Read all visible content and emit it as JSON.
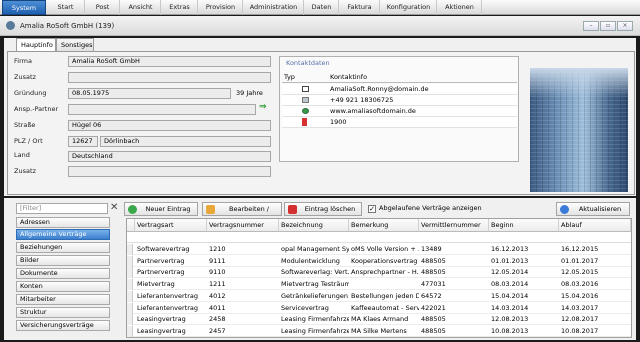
{
  "menu": {
    "items": [
      "System",
      "Start",
      "Post",
      "Ansicht",
      "Extras",
      "Provision",
      "Administration",
      "Daten",
      "Faktura",
      "Konfiguration",
      "Aktionen"
    ]
  },
  "window": {
    "title": "Amalia RoSoft GmbH (139)",
    "controls": [
      "–",
      "▫",
      "×"
    ]
  },
  "tabs": [
    "Hauptinfo",
    "Sonstiges"
  ],
  "form": {
    "firma_label": "Firma",
    "firma": "Amalia RoSoft GmbH",
    "zusatz_label": "Zusatz",
    "zusatz": "",
    "gruendung_label": "Gründung",
    "gruendung": "08.05.1975",
    "alter": "39 Jahre",
    "ansp_label": "Ansp.-Partner",
    "ansp": "",
    "strasse_label": "Straße",
    "strasse": "Hügel 06",
    "plz_label": "PLZ / Ort",
    "plz": "12627",
    "ort": "Dörlinbach",
    "land_label": "Land",
    "land": "Deutschland",
    "zusatz2_label": "Zusatz",
    "zusatz2": ""
  },
  "contact": {
    "title": "Kontaktdaten",
    "col_typ": "Typ",
    "col_info": "Kontaktinfo",
    "rows": [
      {
        "icon": "envelope-icon",
        "value": "AmaliaSoft.Ronny@domain.de"
      },
      {
        "icon": "phone-icon",
        "value": "+49 921 18306725"
      },
      {
        "icon": "globe-icon",
        "value": "www.amaliasoftdomain.de"
      },
      {
        "icon": "mobile-icon",
        "value": "1900"
      }
    ]
  },
  "filter": {
    "placeholder": "[Filter]"
  },
  "nav": {
    "items": [
      "Adressen",
      "Allgemeine Verträge",
      "Beziehungen",
      "Bilder",
      "Dokumente",
      "Konten",
      "Mitarbeiter",
      "Struktur",
      "Versicherungsverträge"
    ],
    "active_index": 1
  },
  "toolbar": {
    "new_label": "Neuer Eintrag",
    "edit_label": "Bearbeiten / Details",
    "delete_label": "Eintrag löschen",
    "expired_label": "Abgelaufene Verträge anzeigen",
    "expired_checked": true,
    "refresh_label": "Aktualisieren"
  },
  "grid": {
    "columns": [
      "Vertragsart",
      "Vertragsnummer",
      "Bezeichnung",
      "Bemerkung",
      "Vermittlernummer",
      "Beginn",
      "Ablauf"
    ],
    "rows": [
      [
        "Softwarevertrag",
        "1210",
        "opal Management Sy...",
        "oMS Volle Version + ...",
        "13489",
        "16.12.2013",
        "16.12.2015"
      ],
      [
        "Partnervertrag",
        "9111",
        "Modulentwicklung",
        "Kooperationsvertrag",
        "488505",
        "01.01.2013",
        "01.01.2017"
      ],
      [
        "Partnervertrag",
        "9110",
        "Softwareverlag: Vert...",
        "Ansprechpartner - H...",
        "488505",
        "12.05.2014",
        "12.05.2015"
      ],
      [
        "Mietvertrag",
        "1211",
        "Mietvertrag Testräume",
        "",
        "477031",
        "08.03.2014",
        "08.03.2016"
      ],
      [
        "Lieferantenvertrag",
        "4012",
        "Getränkelieferungen",
        "Bestellungen jeden D...",
        "64572",
        "15.04.2014",
        "15.04.2016"
      ],
      [
        "Lieferantenvertrag",
        "4011",
        "Servicevertrag",
        "Kaffeeautomat - Servic",
        "422021",
        "14.03.2014",
        "14.03.2017"
      ],
      [
        "Leasingvertrag",
        "2458",
        "Leasing Firmenfahrze...",
        "MA Klaes Armand",
        "488505",
        "12.08.2013",
        "12.08.2017"
      ],
      [
        "Leasingvertrag",
        "2457",
        "Leasing Firmenfahrze...",
        "MA Silke Mertens",
        "488505",
        "10.08.2013",
        "10.08.2017"
      ]
    ]
  },
  "colors": {
    "accent": "#2e6fc4",
    "menu_active": "#1e5fb0",
    "contact_title": "#5a6fa8"
  }
}
